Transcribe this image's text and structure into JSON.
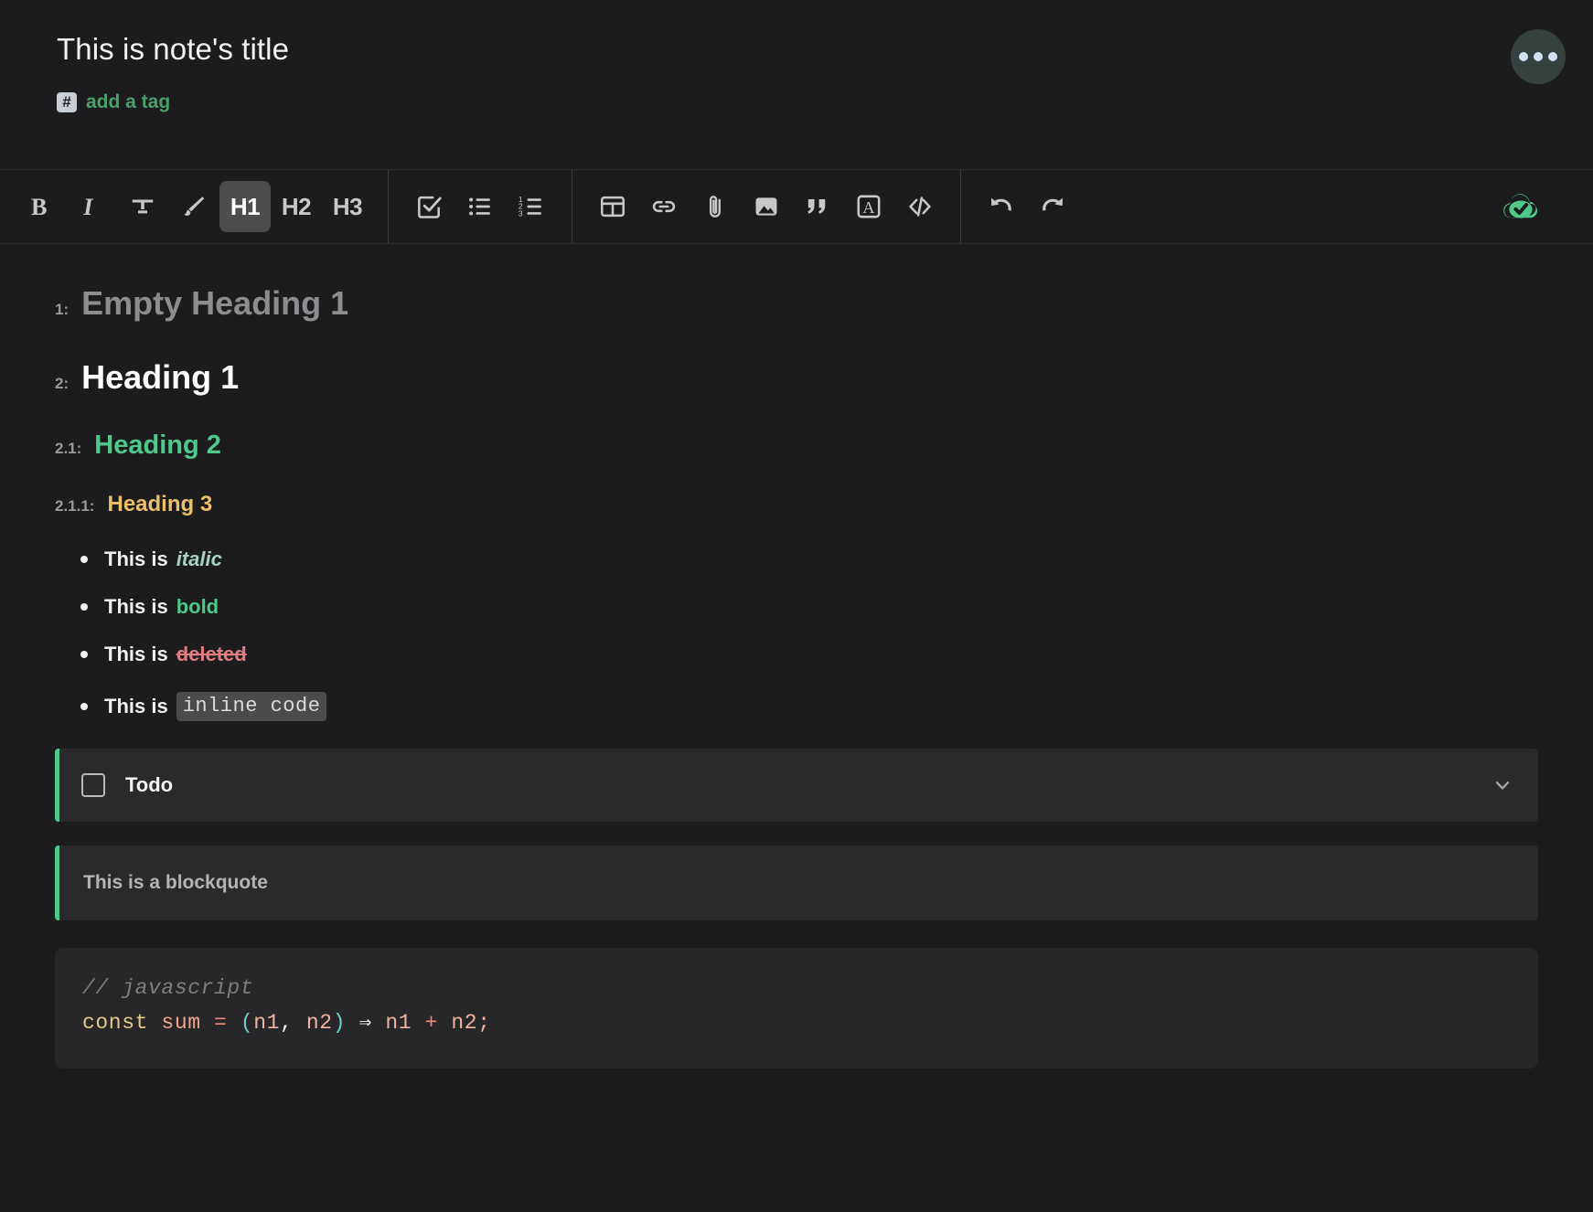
{
  "header": {
    "note_title": "This is note's title",
    "tag_icon": "hash-icon",
    "add_tag_label": "add a tag",
    "menu_button": "more-options"
  },
  "toolbar": {
    "groups": [
      {
        "name": "formatting",
        "items": [
          {
            "name": "bold-button",
            "label": "B",
            "icon": "bold-icon",
            "active": false
          },
          {
            "name": "italic-button",
            "label": "I",
            "icon": "italic-icon",
            "active": false
          },
          {
            "name": "strikethrough-button",
            "label": "",
            "icon": "strikethrough-icon",
            "active": false
          },
          {
            "name": "highlight-button",
            "label": "",
            "icon": "brush-icon",
            "active": false
          },
          {
            "name": "heading-1-button",
            "label": "H1",
            "icon": "h1-icon",
            "active": true
          },
          {
            "name": "heading-2-button",
            "label": "H2",
            "icon": "h2-icon",
            "active": false
          },
          {
            "name": "heading-3-button",
            "label": "H3",
            "icon": "h3-icon",
            "active": false
          }
        ]
      },
      {
        "name": "lists",
        "items": [
          {
            "name": "checklist-button",
            "label": "",
            "icon": "checkbox-icon",
            "active": false
          },
          {
            "name": "bullet-list-button",
            "label": "",
            "icon": "bullet-list-icon",
            "active": false
          },
          {
            "name": "numbered-list-button",
            "label": "",
            "icon": "numbered-list-icon",
            "active": false
          }
        ]
      },
      {
        "name": "insert",
        "items": [
          {
            "name": "table-button",
            "label": "",
            "icon": "table-icon",
            "active": false
          },
          {
            "name": "link-button",
            "label": "",
            "icon": "link-icon",
            "active": false
          },
          {
            "name": "attachment-button",
            "label": "",
            "icon": "paperclip-icon",
            "active": false
          },
          {
            "name": "image-button",
            "label": "",
            "icon": "image-icon",
            "active": false
          },
          {
            "name": "blockquote-button",
            "label": "",
            "icon": "quote-icon",
            "active": false
          },
          {
            "name": "text-box-button",
            "label": "",
            "icon": "boxed-a-icon",
            "active": false
          },
          {
            "name": "code-block-button",
            "label": "",
            "icon": "code-icon",
            "active": false
          }
        ]
      },
      {
        "name": "history",
        "items": [
          {
            "name": "undo-button",
            "label": "",
            "icon": "undo-icon",
            "active": false
          },
          {
            "name": "redo-button",
            "label": "",
            "icon": "redo-icon",
            "active": false
          }
        ]
      }
    ],
    "save_status": {
      "icon": "cloud-check-icon",
      "color": "#4ec98a"
    }
  },
  "editor": {
    "headings": [
      {
        "number": "1:",
        "text": "Empty Heading 1",
        "level": 1,
        "state": "placeholder"
      },
      {
        "number": "2:",
        "text": "Heading 1",
        "level": 1,
        "state": "normal"
      },
      {
        "number": "2.1:",
        "text": "Heading 2",
        "level": 2,
        "state": "normal"
      },
      {
        "number": "2.1.1:",
        "text": "Heading 3",
        "level": 3,
        "state": "normal"
      }
    ],
    "bullets": [
      {
        "prefix": "This is",
        "emphasis": "italic",
        "style": "italic"
      },
      {
        "prefix": "This is",
        "emphasis": "bold",
        "style": "bold"
      },
      {
        "prefix": "This is",
        "emphasis": "deleted",
        "style": "strikethrough"
      },
      {
        "prefix": "This is",
        "emphasis": "inline code",
        "style": "code"
      }
    ],
    "todo": {
      "label": "Todo",
      "checked": false,
      "chevron": "chevron-down-icon"
    },
    "blockquote": {
      "text": "This is a blockquote"
    },
    "code_block": {
      "comment": "// javascript",
      "tokens": [
        {
          "text": "const",
          "type": "kw"
        },
        {
          "text": " ",
          "type": "plain"
        },
        {
          "text": "sum",
          "type": "fn"
        },
        {
          "text": " ",
          "type": "plain"
        },
        {
          "text": "=",
          "type": "op"
        },
        {
          "text": " ",
          "type": "plain"
        },
        {
          "text": "(",
          "type": "par"
        },
        {
          "text": "n1",
          "type": "var"
        },
        {
          "text": ", ",
          "type": "plain"
        },
        {
          "text": "n2",
          "type": "var"
        },
        {
          "text": ")",
          "type": "par"
        },
        {
          "text": " ",
          "type": "plain"
        },
        {
          "text": "⇒",
          "type": "plain"
        },
        {
          "text": " ",
          "type": "plain"
        },
        {
          "text": "n1",
          "type": "var"
        },
        {
          "text": " ",
          "type": "plain"
        },
        {
          "text": "+",
          "type": "op"
        },
        {
          "text": " ",
          "type": "plain"
        },
        {
          "text": "n2;",
          "type": "var"
        }
      ]
    }
  },
  "colors": {
    "background": "#1c1c1e",
    "block_background": "#2a2a2c",
    "accent_green": "#4ec98a",
    "accent_yellow": "#ecc06a",
    "accent_red": "#e07d83",
    "tag_green": "#4aa06d"
  }
}
